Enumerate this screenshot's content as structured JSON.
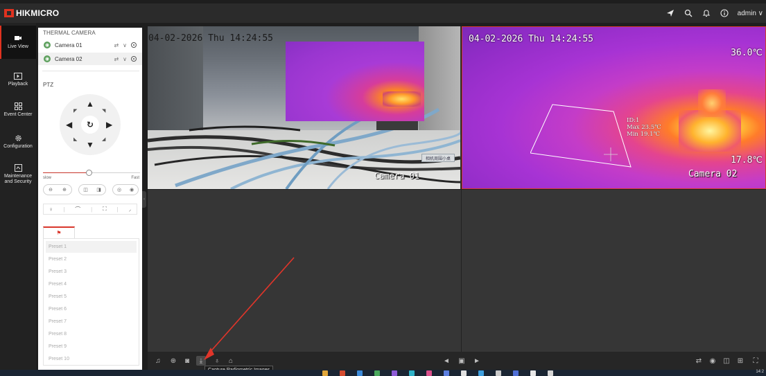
{
  "app": {
    "brand": "HIKMICRO",
    "user": "admin",
    "top_icons": [
      "send-icon",
      "search-icon",
      "bell-icon",
      "info-icon"
    ]
  },
  "nav": {
    "items": [
      {
        "label": "Live View",
        "icon": "monitor-icon",
        "active": true
      },
      {
        "label": "Playback",
        "icon": "play-icon",
        "active": false
      },
      {
        "label": "Event Center",
        "icon": "grid-icon",
        "active": false
      },
      {
        "label": "Configuration",
        "icon": "gear-icon",
        "active": false
      },
      {
        "label": "Maintenance and Security",
        "icon": "shield-icon",
        "active": false
      }
    ]
  },
  "panel": {
    "title": "THERMAL CAMERA",
    "cameras": [
      {
        "name": "Camera 01",
        "selected": false
      },
      {
        "name": "Camera 02",
        "selected": true
      }
    ],
    "ptz_label": "PTZ",
    "speed": {
      "slow_label": "slow",
      "fast_label": "Fast",
      "value": 0.47
    },
    "presets": [
      "Preset 1",
      "Preset 2",
      "Preset 3",
      "Preset 4",
      "Preset 5",
      "Preset 6",
      "Preset 7",
      "Preset 8",
      "Preset 9",
      "Preset 10"
    ]
  },
  "views": {
    "camera1": {
      "timestamp": "04-02-2026 Thu 14:24:55",
      "name": "Camera 01",
      "sticker": "相机周围小桌"
    },
    "camera2": {
      "timestamp": "04-02-2026 Thu 14:24:55",
      "name": "Camera 02",
      "temp_max_scale": "36.0℃",
      "temp_min_scale": "17.8℃",
      "roi_id": "ID:1",
      "roi_max": "Max 23.5℃",
      "roi_min": "Min 19.1℃"
    }
  },
  "toolbar": {
    "tooltip": "Capture Radiometric Images"
  },
  "taskbar": {
    "time": "14:2"
  },
  "colors": {
    "accent": "#e0321f",
    "selected_border": "#d33a2c"
  }
}
